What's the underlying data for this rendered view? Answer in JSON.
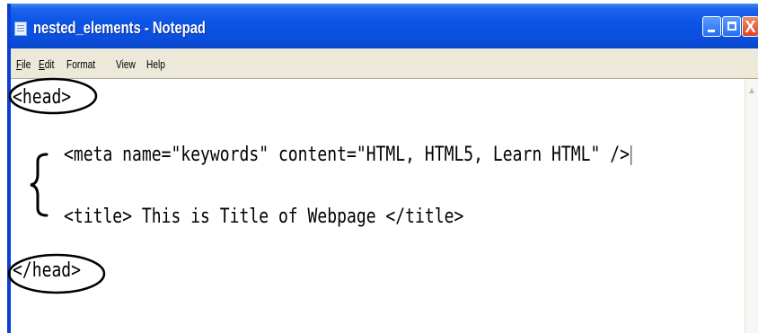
{
  "window": {
    "title": "nested_elements - Notepad",
    "controls": {
      "minimize": "minimize",
      "maximize": "maximize",
      "close": "X"
    }
  },
  "menu": [
    {
      "acc": "F",
      "rest": "ile"
    },
    {
      "acc": "E",
      "rest": "dit"
    },
    {
      "acc": "",
      "rest": "Format"
    },
    {
      "acc": "",
      "rest": "View"
    },
    {
      "acc": "",
      "rest": "Help"
    }
  ],
  "editor": {
    "lines": [
      "<head>",
      "<meta name=\"keywords\" content=\"HTML, HTML5, Learn HTML\" />",
      "<title> This is Title of Webpage </title>",
      "</head>"
    ]
  },
  "colors": {
    "titlebar": "#0a4fdf",
    "menubar": "#ece9d8",
    "annotation": "#000000"
  },
  "icons": [
    "notepad-icon",
    "minimize-icon",
    "maximize-icon",
    "close-icon",
    "scroll-up-arrow-icon"
  ]
}
